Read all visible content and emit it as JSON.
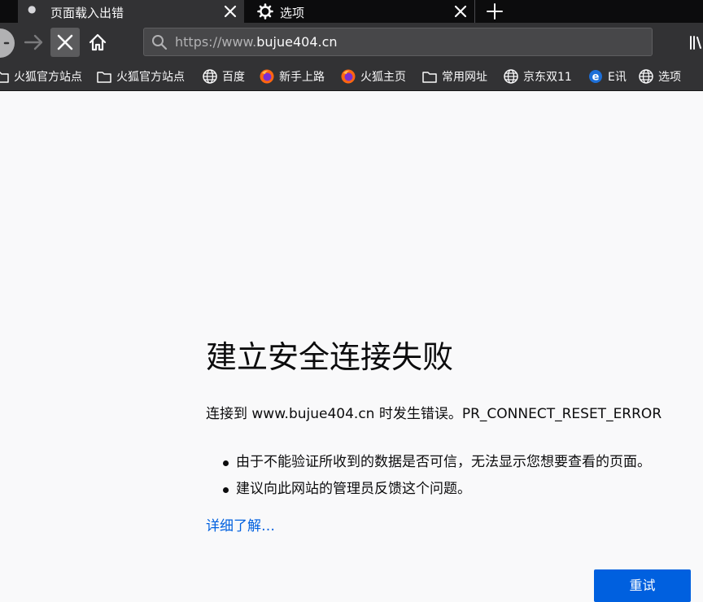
{
  "tabs": [
    {
      "label": "页面载入出错",
      "state": "active"
    },
    {
      "label": "选项",
      "state": "inactive",
      "icon": "gear-icon"
    }
  ],
  "nav": {
    "url_prefix": "https://www.",
    "url_host": "bujue404.cn"
  },
  "bookmarks": [
    {
      "label": "火狐官方站点",
      "icon": "folder-icon"
    },
    {
      "label": "火狐官方站点",
      "icon": "folder-icon"
    },
    {
      "label": "百度",
      "icon": "globe-icon"
    },
    {
      "label": "新手上路",
      "icon": "firefox-icon"
    },
    {
      "label": "火狐主页",
      "icon": "firefox-icon"
    },
    {
      "label": "常用网址",
      "icon": "folder-icon"
    },
    {
      "label": "京东双11",
      "icon": "globe-icon"
    },
    {
      "label": "E讯",
      "icon": "e-icon"
    },
    {
      "label": "选项",
      "icon": "globe-icon"
    }
  ],
  "error": {
    "title": "建立安全连接失败",
    "description": "连接到 www.bujue404.cn 时发生错误。PR_CONNECT_RESET_ERROR",
    "bullets": [
      "由于不能验证所收到的数据是否可信，无法显示您想要查看的页面。",
      "建议向此网站的管理员反馈这个问题。"
    ],
    "learn_more": "详细了解…",
    "retry_label": "重试"
  },
  "colors": {
    "accent": "#0060df",
    "toolbar": "#323234",
    "tabstrip": "#0c0c0d",
    "page_bg": "#f9f9fa"
  }
}
